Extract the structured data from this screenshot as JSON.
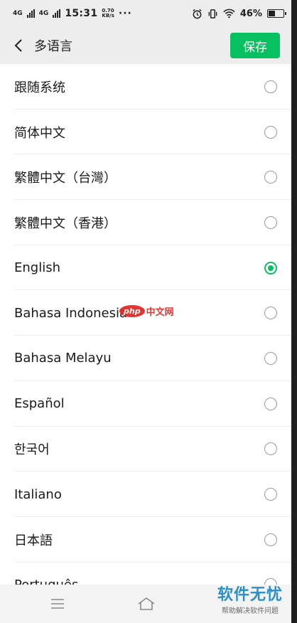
{
  "status_bar": {
    "network_top": "4G",
    "network_bottom": "4G",
    "time": "15:31",
    "speed_value": "0.70",
    "speed_unit": "KB/s",
    "dots": "···",
    "battery_percent": "46%",
    "battery_level": 0.46
  },
  "header": {
    "title": "多语言",
    "save_label": "保存"
  },
  "languages": [
    {
      "label": "跟随系统",
      "selected": false
    },
    {
      "label": "简体中文",
      "selected": false
    },
    {
      "label": "繁體中文（台灣）",
      "selected": false
    },
    {
      "label": "繁體中文（香港）",
      "selected": false
    },
    {
      "label": "English",
      "selected": true
    },
    {
      "label": "Bahasa Indonesia",
      "selected": false
    },
    {
      "label": "Bahasa Melayu",
      "selected": false
    },
    {
      "label": "Español",
      "selected": false
    },
    {
      "label": "한국어",
      "selected": false
    },
    {
      "label": "Italiano",
      "selected": false
    },
    {
      "label": "日本語",
      "selected": false
    },
    {
      "label": "Português",
      "selected": false
    }
  ],
  "watermarks": {
    "php_logo": "php",
    "php_cn": "中文网",
    "soft_title": "软件无忧",
    "soft_sub": "帮助解决软件问题"
  },
  "colors": {
    "accent": "#07c160",
    "background": "#ededed"
  }
}
